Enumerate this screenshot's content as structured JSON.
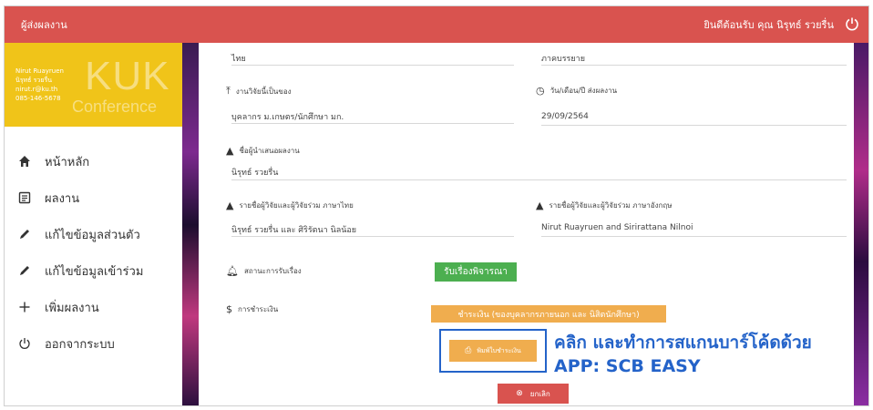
{
  "topbar": {
    "brand": "ผู้ส่งผลงาน",
    "welcome": "ยินดีต้อนรับ คุณ นิรุทธ์ รวยรื่น",
    "power_icon": "power-icon"
  },
  "profile": {
    "name_en": "Nirut Ruayruen",
    "name_th": "นิรุทธ์ รวยรื่น",
    "email": "nirut.r@ku.th",
    "phone": "085-146-5678",
    "logo_kuk": "KUK",
    "logo_conference": "Conference"
  },
  "menu": [
    {
      "label": "หน้าหลัก",
      "icon": "home-icon"
    },
    {
      "label": "ผลงาน",
      "icon": "document-icon"
    },
    {
      "label": "แก้ไขข้อมูลส่วนตัว",
      "icon": "pencil-icon"
    },
    {
      "label": "แก้ไขข้อมูลเข้าร่วม",
      "icon": "pencil-icon"
    },
    {
      "label": "เพิ่มผลงาน",
      "icon": "plus-icon"
    },
    {
      "label": "ออกจากระบบ",
      "icon": "power-icon"
    }
  ],
  "form": {
    "language_value": "ไทย",
    "type_value": "ภาคบรรยาย",
    "owner_label": "งานวิจัยนี้เป็นของ",
    "owner_value": "บุคลากร ม.เกษตร/นักศึกษา มก.",
    "date_label": "วัน/เดือน/ปี ส่งผลงาน",
    "date_value": "29/09/2564",
    "presenter_label": "ชื่อผู้นำเสนอผลงาน",
    "presenter_value": "นิรุทธ์ รวยรื่น",
    "authors_th_label": "รายชื่อผู้วิจัยและผู้วิจัยร่วม ภาษาไทย",
    "authors_th_value": "นิรุทธ์ รวยรื่น และ ศิริรัตนา นิลน้อย",
    "authors_en_label": "รายชื่อผู้วิจัยและผู้วิจัยร่วม ภาษาอังกฤษ",
    "authors_en_value": "Nirut Ruayruen and Sirirattana Nilnoi",
    "status_label": "สถานะการรับเรื่อง",
    "status_button": "รับเรื่องพิจารณา",
    "payment_label": "การชำระเงิน",
    "payment_button": "ชำระเงิน (ของบุคลากรภายนอก และ นิสิตนักศึกษา)",
    "print_button": "พิมพ์ใบชำระเงิน",
    "cancel_button": "ยกเลิก"
  },
  "annotation": {
    "line1": "คลิก และทำการสแกนบาร์โค้ดด้วย",
    "line2": "APP: SCB EASY"
  },
  "colors": {
    "topbar": "#d9534f",
    "profile": "#f0c419",
    "green": "#4caf50",
    "orange": "#f0ad4e",
    "annotation": "#2463c9"
  }
}
